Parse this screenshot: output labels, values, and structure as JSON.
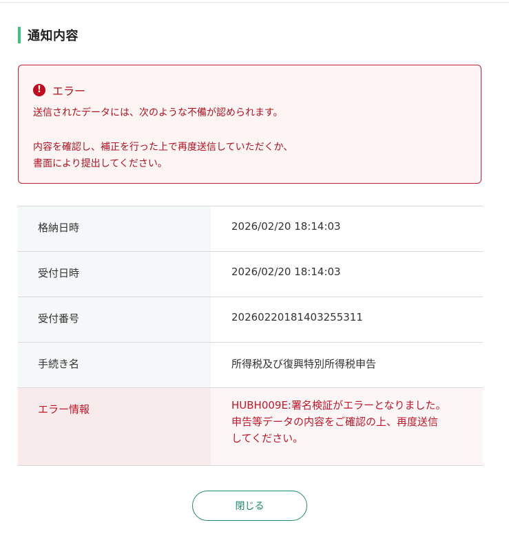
{
  "section": {
    "title": "通知内容"
  },
  "error_box": {
    "icon": "exclamation-circle-icon",
    "title": "エラー",
    "line1": "送信されたデータには、次のような不備が認められます。",
    "line2": "内容を確認し、補正を行った上で再度送信していただくか、",
    "line3": "書面により提出してください。"
  },
  "table": {
    "rows": [
      {
        "label": "格納日時",
        "value": "2026/02/20 18:14:03"
      },
      {
        "label": "受付日時",
        "value": "2026/02/20 18:14:03"
      },
      {
        "label": "受付番号",
        "value": "20260220181403255311"
      },
      {
        "label": "手続き名",
        "value": "所得税及び復興特別所得税申告"
      }
    ],
    "error_row": {
      "label": "エラー情報",
      "lines": [
        "HUBH009E:署名検証がエラーとなりました。",
        "申告等データの内容をご確認の上、再度送信",
        "してください。"
      ]
    }
  },
  "footer": {
    "close_label": "閉じる"
  },
  "colors": {
    "accent": "#3cc47c",
    "error": "#c0172a",
    "button": "#1f8a6b"
  }
}
